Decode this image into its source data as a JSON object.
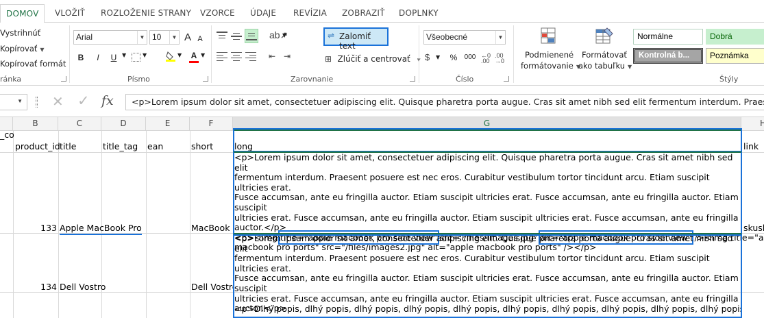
{
  "tabs": [
    "DOMOV",
    "VLOŽIŤ",
    "ROZLOŽENIE STRANY",
    "VZORCE",
    "ÚDAJE",
    "REVÍZIA",
    "ZOBRAZIŤ",
    "DOPLNKY"
  ],
  "clipboard": {
    "cut": "Vystrihnúť",
    "copy": "Kopírovať",
    "format_painter": "Kopírovať formát",
    "group_label": "ránka"
  },
  "font": {
    "name": "Arial",
    "size": "10",
    "bold": "B",
    "italic": "I",
    "underline": "U",
    "font_color_glyph": "A",
    "grow": "A",
    "shrink": "A",
    "group_label": "Písmo"
  },
  "alignment": {
    "wrap_text": "Zalomiť text",
    "merge_center": "Zlúčiť a centrovať",
    "group_label": "Zarovnanie"
  },
  "number": {
    "format": "Všeobecné",
    "currency": "$",
    "percent": "%",
    "comma": "000",
    "inc_decimal": "",
    "group_label": "Číslo"
  },
  "styles": {
    "conditional_line1": "Podmienené",
    "conditional_line2": "formátovanie",
    "table_line1": "Formátovať",
    "table_line2": "ako tabuľku",
    "normal": "Normálne",
    "good": "Dobrá",
    "check": "Kontrolná b...",
    "note": "Poznámka",
    "group_label": "Štýly"
  },
  "formula_bar": {
    "cancel": "✕",
    "enter": "✓",
    "fx": "fx",
    "content": "<p>Lorem ipsum dolor sit amet, consectetuer adipiscing elit. Quisque pharetra porta augue. Cras sit amet nibh sed elit fermentum interdum. Praesent"
  },
  "columns": [
    "B",
    "C",
    "D",
    "E",
    "F",
    "G",
    "H"
  ],
  "header_row": {
    "a": "_co",
    "b": "product_id",
    "c": "title",
    "d": "title_tag",
    "e": "ean",
    "f": "short",
    "g": "long",
    "h": "link"
  },
  "rows": [
    {
      "product_id": "133",
      "title": "Apple MacBook Pro",
      "short": "MacBook",
      "link": "skusl",
      "long_lines": [
        "<p>Lorem ipsum dolor sit amet, consectetuer adipiscing elit. Quisque pharetra porta augue. Cras sit amet nibh sed elit",
        "fermentum interdum. Praesent posuere est nec eros. Curabitur vestibulum tortor tincidunt arcu. Etiam suscipit ultricies erat.",
        "Fusce accumsan, ante eu fringilla auctor. Etiam suscipit ultricies erat. Fusce accumsan, ante eu fringilla auctor. Etiam suscipit",
        "ultricies erat. Fusce accumsan, ante eu fringilla auctor. Etiam suscipit ultricies erat. Fusce accumsan, ante eu fringilla",
        "auctor.</p>"
      ],
      "long_img_pre": "<p><img ",
      "long_img_title": "title=\"apple macbook pro side view\"",
      "long_img_mid": " src=\"/files/images.jpg\" ",
      "long_img_alt": "alt=\"apple macbook pro side view\"",
      "long_img_post": " /><img title=\"apple",
      "long_img_line2": "macbook pro ports\" src=\"/files/images2.jpg\" alt=\"apple macbook pro ports\" /></p>"
    },
    {
      "product_id": "134",
      "title": "Dell Vostro",
      "short": "Dell Vostro",
      "link": "",
      "long_lines": [
        "<p>Lorem ipsum dolor sit amet, consectetuer adipiscing elit. Quisque pharetra porta augue. Cras sit amet nibh sed elit",
        "fermentum interdum. Praesent posuere est nec eros. Curabitur vestibulum tortor tincidunt arcu. Etiam suscipit ultricies erat.",
        "Fusce accumsan, ante eu fringilla auctor. Etiam suscipit ultricies erat. Fusce accumsan, ante eu fringilla auctor. Etiam suscipit",
        "ultricies erat. Fusce accumsan, ante eu fringilla auctor. Etiam suscipit ultricies erat. Fusce accumsan, ante eu fringilla",
        "auctor.</p>"
      ]
    },
    {
      "long_lines": [
        "<p>Dlhý popis, dlhý popis, dlhý popis, dlhý popis, dlhý popis, dlhý popis, dlhý popis, dlhý popis, dlhý popis, dlhý popis, dlhý"
      ]
    }
  ],
  "colors": {
    "excel_green": "#217346",
    "highlight_blue": "#1a72d9"
  }
}
